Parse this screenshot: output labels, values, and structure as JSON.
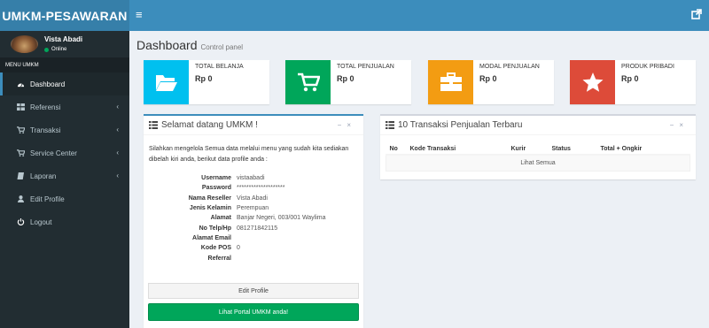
{
  "app": {
    "title": "UMKM-PESAWARAN"
  },
  "header": {
    "menu_icon": "hamburger-icon",
    "right_icon": "external-link-icon"
  },
  "sidebar": {
    "user": {
      "name": "Vista Abadi",
      "status": "Online"
    },
    "menu_header": "MENU UMKM",
    "items": [
      {
        "label": "Dashboard",
        "icon": "dashboard-icon",
        "active": true,
        "has_submenu": false
      },
      {
        "label": "Referensi",
        "icon": "grid-icon",
        "active": false,
        "has_submenu": true
      },
      {
        "label": "Transaksi",
        "icon": "cart-icon",
        "active": false,
        "has_submenu": true
      },
      {
        "label": "Service Center",
        "icon": "cart-icon",
        "active": false,
        "has_submenu": true
      },
      {
        "label": "Laporan",
        "icon": "book-icon",
        "active": false,
        "has_submenu": true
      },
      {
        "label": "Edit Profile",
        "icon": "user-icon",
        "active": false,
        "has_submenu": false
      },
      {
        "label": "Logout",
        "icon": "power-icon",
        "active": false,
        "has_submenu": false
      }
    ]
  },
  "page": {
    "title": "Dashboard",
    "subtitle": "Control panel"
  },
  "info_boxes": [
    {
      "label": "TOTAL BELANJA",
      "value": "Rp 0",
      "color": "#00c0ef",
      "icon": "folder-open-icon"
    },
    {
      "label": "TOTAL PENJUALAN",
      "value": "Rp 0",
      "color": "#00a65a",
      "icon": "cart-icon"
    },
    {
      "label": "MODAL PENJUALAN",
      "value": "Rp 0",
      "color": "#f39c12",
      "icon": "briefcase-icon"
    },
    {
      "label": "PRODUK PRIBADI",
      "value": "Rp 0",
      "color": "#dd4b39",
      "icon": "star-icon"
    }
  ],
  "welcome": {
    "title": "Selamat datang UMKM !",
    "intro": "Silahkan mengelola Semua data melalui menu yang sudah kita sediakan dibelah kiri anda, berikut data profile anda :",
    "fields": [
      {
        "label": "Username",
        "value": "vistaabadi"
      },
      {
        "label": "Password",
        "value": "********************"
      },
      {
        "label": "Nama Reseller",
        "value": "Vista Abadi"
      },
      {
        "label": "Jenis Kelamin",
        "value": "Perempuan"
      },
      {
        "label": "Alamat",
        "value": "Banjar Negeri, 003/001 Waylima"
      },
      {
        "label": "No Telp/Hp",
        "value": "081271842115"
      },
      {
        "label": "Alamat Email",
        "value": ""
      },
      {
        "label": "Kode POS",
        "value": "0"
      },
      {
        "label": "Referral",
        "value": ""
      }
    ],
    "edit_button": "Edit Profile",
    "portal_button": "Lihat Portal UMKM anda!"
  },
  "transactions": {
    "title": "10 Transaksi Penjualan Terbaru",
    "columns": [
      "No",
      "Kode Transaksi",
      "Kurir",
      "Status",
      "Total + Ongkir"
    ],
    "see_all": "Lihat Semua"
  },
  "box_tools": {
    "collapse": "−",
    "close": "×"
  }
}
